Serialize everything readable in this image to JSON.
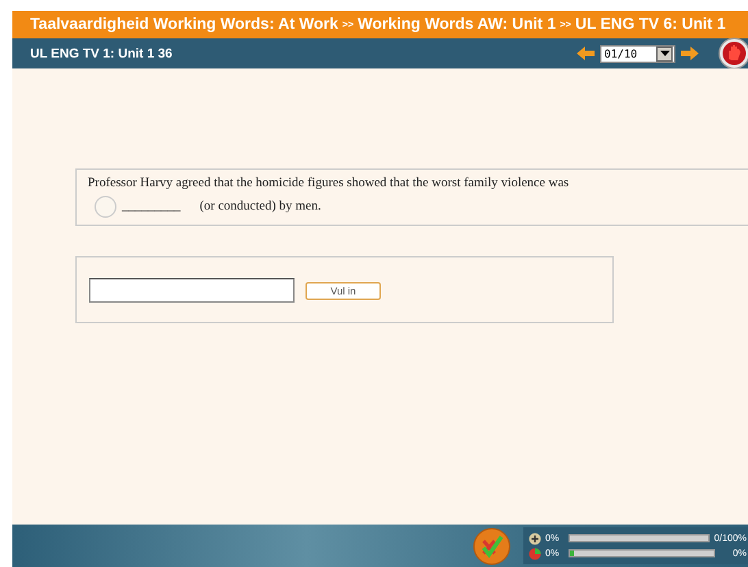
{
  "breadcrumb": {
    "items": [
      "Taalvaardigheid Working Words: At Work",
      "Working Words AW: Unit 1",
      "UL ENG TV 6: Unit 1"
    ],
    "separator": ">>"
  },
  "toolbar": {
    "title": "UL ENG TV 1: Unit 1 36",
    "page_select": {
      "value": "01/10"
    }
  },
  "question": {
    "text": "Professor Harvy agreed that the homicide figures showed that the worst family violence was",
    "blank": "_________",
    "text_after": "(or conducted) by men."
  },
  "answer": {
    "button": "Vul in"
  },
  "progress": [
    {
      "kind": "score",
      "label": "0%",
      "level": 0,
      "reading": "0/100%"
    },
    {
      "kind": "done",
      "label": "0%",
      "level": 0.03,
      "reading": "0%"
    }
  ]
}
